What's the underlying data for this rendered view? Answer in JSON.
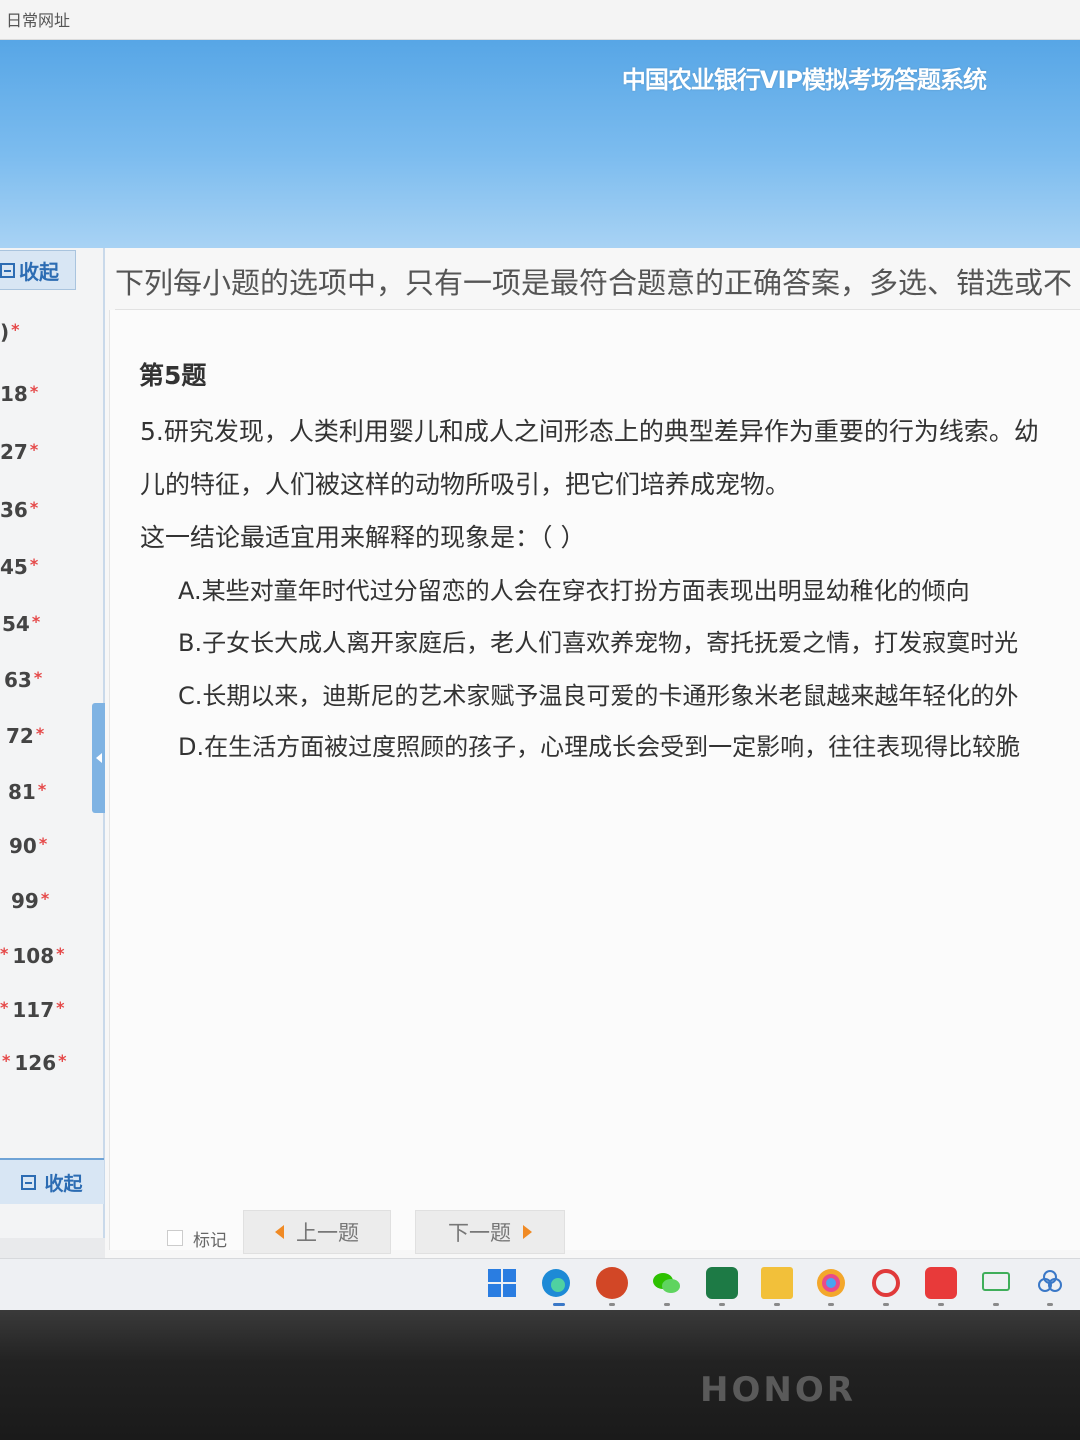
{
  "bookmarks": {
    "label": "日常网址"
  },
  "header": {
    "title": "中国农业银行VIP模拟考场答题系统"
  },
  "sidebar": {
    "collapse_top": "收起",
    "collapse_bottom": "收起",
    "items": [
      {
        "label": ")"
      },
      {
        "label": "18"
      },
      {
        "label": "27"
      },
      {
        "label": "36"
      },
      {
        "label": "45"
      },
      {
        "label": "54"
      },
      {
        "label": "63"
      },
      {
        "label": "72"
      },
      {
        "label": "81"
      },
      {
        "label": "90"
      },
      {
        "label": "99"
      },
      {
        "label": "108"
      },
      {
        "label": "117"
      },
      {
        "label": "126"
      }
    ],
    "star": "*"
  },
  "main": {
    "instruction": "下列每小题的选项中，只有一项是最符合题意的正确答案，多选、错选或不",
    "question_number": "第5题",
    "stem_line1": "5.研究发现，人类利用婴儿和成人之间形态上的典型差异作为重要的行为线索。幼",
    "stem_line2": "儿的特征，人们被这样的动物所吸引，把它们培养成宠物。",
    "stem_line3": "这一结论最适宜用来解释的现象是：（    ）",
    "options": {
      "a": "A.某些对童年时代过分留恋的人会在穿衣打扮方面表现出明显幼稚化的倾向",
      "b": "B.子女长大成人离开家庭后，老人们喜欢养宠物，寄托抚爱之情，打发寂寞时光",
      "c": "C.长期以来，迪斯尼的艺术家赋予温良可爱的卡通形象米老鼠越来越年轻化的外",
      "d": "D.在生活方面被过度照顾的孩子，心理成长会受到一定影响，往往表现得比较脆"
    }
  },
  "nav": {
    "mark_label": "标记",
    "prev_label": "上一题",
    "next_label": "下一题"
  },
  "taskbar": {
    "icons": [
      "windows-start-icon",
      "edge-icon",
      "powerpoint-icon",
      "wechat-icon",
      "excel-icon",
      "file-explorer-icon",
      "chrome-icon",
      "app-icon",
      "netease-music-icon",
      "screen-icon",
      "network-icon"
    ]
  },
  "device": {
    "brand": "HONOR"
  }
}
